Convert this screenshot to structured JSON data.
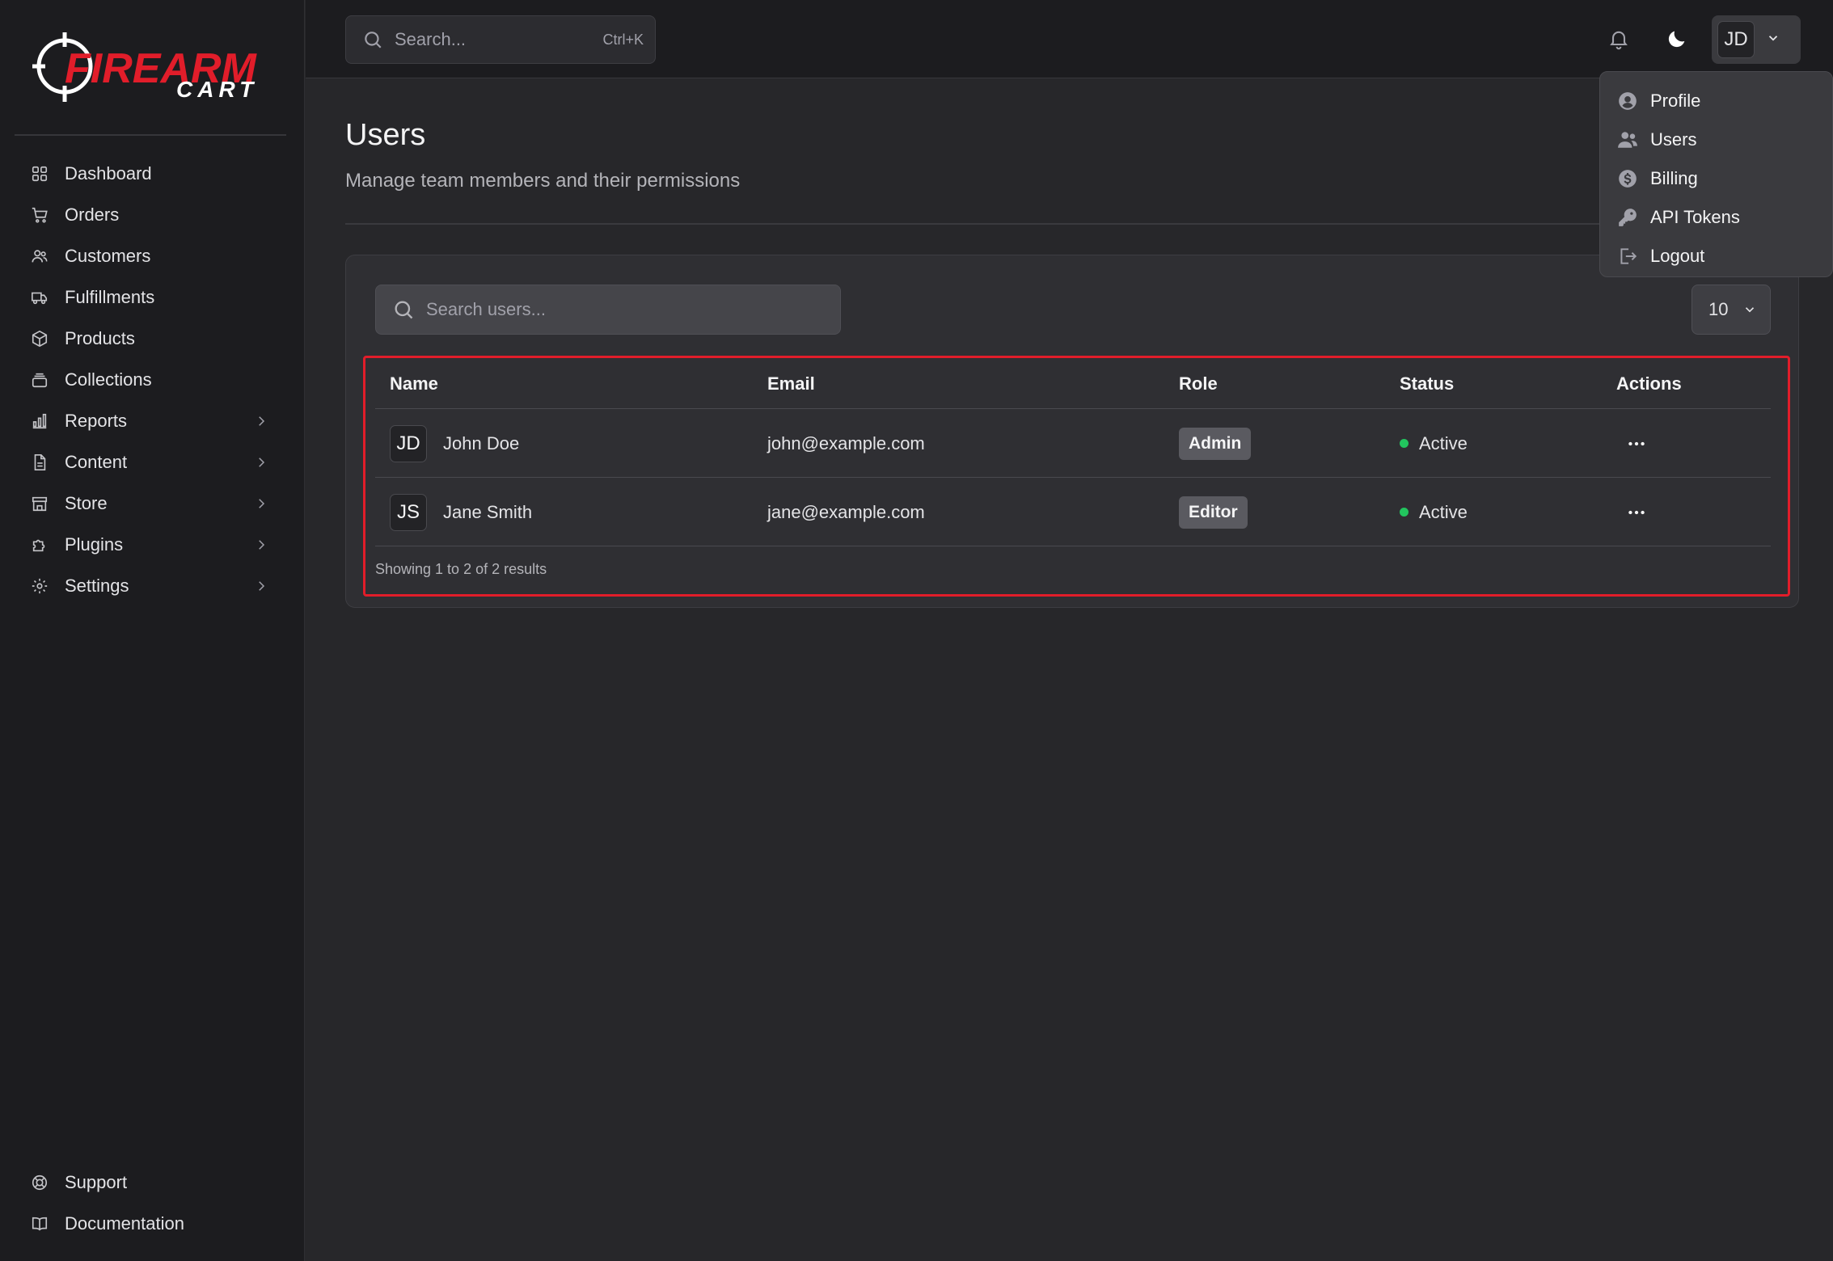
{
  "brand": {
    "name_line1": "FIREARM",
    "name_line2": "CART",
    "accent": "#e11d2a"
  },
  "sidebar": {
    "items": [
      {
        "label": "Dashboard",
        "icon": "grid-icon"
      },
      {
        "label": "Orders",
        "icon": "cart-icon"
      },
      {
        "label": "Customers",
        "icon": "users-icon"
      },
      {
        "label": "Fulfillments",
        "icon": "truck-icon"
      },
      {
        "label": "Products",
        "icon": "box-icon"
      },
      {
        "label": "Collections",
        "icon": "stack-icon"
      },
      {
        "label": "Reports",
        "icon": "bar-chart-icon",
        "expandable": true
      },
      {
        "label": "Content",
        "icon": "document-icon",
        "expandable": true
      },
      {
        "label": "Store",
        "icon": "store-icon",
        "expandable": true
      },
      {
        "label": "Plugins",
        "icon": "puzzle-icon",
        "expandable": true
      },
      {
        "label": "Settings",
        "icon": "gear-icon",
        "expandable": true
      }
    ],
    "bottom": [
      {
        "label": "Support",
        "icon": "lifebuoy-icon"
      },
      {
        "label": "Documentation",
        "icon": "book-icon"
      }
    ]
  },
  "header": {
    "search_placeholder": "Search...",
    "search_shortcut": "Ctrl+K",
    "user_initials": "JD"
  },
  "user_menu": {
    "items": [
      {
        "label": "Profile",
        "icon": "user-circle-icon"
      },
      {
        "label": "Users",
        "icon": "users-icon"
      },
      {
        "label": "Billing",
        "icon": "dollar-icon"
      },
      {
        "label": "API Tokens",
        "icon": "key-icon"
      },
      {
        "label": "Logout",
        "icon": "logout-icon"
      }
    ]
  },
  "page": {
    "title": "Users",
    "subtitle": "Manage team members and their permissions"
  },
  "table": {
    "search_placeholder": "Search users...",
    "page_size": "10",
    "columns": [
      "Name",
      "Email",
      "Role",
      "Status",
      "Actions"
    ],
    "rows": [
      {
        "initials": "JD",
        "name": "John Doe",
        "email": "john@example.com",
        "role": "Admin",
        "status": "Active"
      },
      {
        "initials": "JS",
        "name": "Jane Smith",
        "email": "jane@example.com",
        "role": "Editor",
        "status": "Active"
      }
    ],
    "footer": "Showing 1 to 2 of 2 results"
  }
}
